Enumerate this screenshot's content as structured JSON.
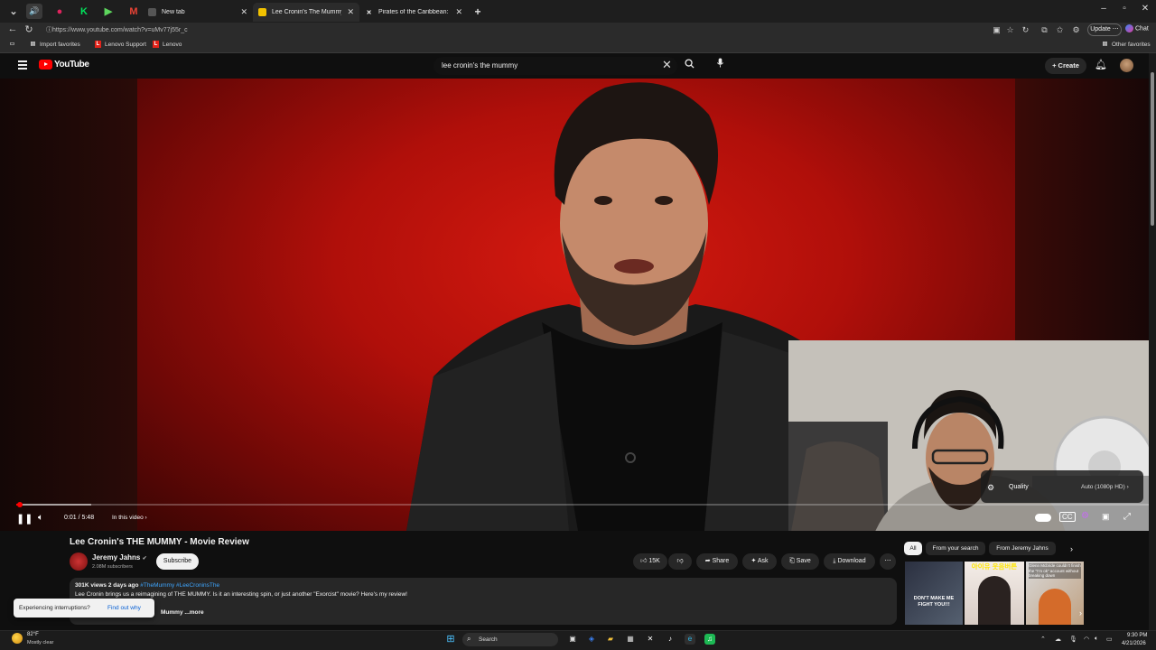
{
  "browser": {
    "tabs": [
      {
        "label": "New tab"
      },
      {
        "label": "Lee Cronin's The Mummy (2026) -"
      },
      {
        "label": "Pirates of the Caribbean: Dead M..."
      }
    ],
    "url": "https://www.youtube.com/watch?v=uMv77j55r_c",
    "update_label": "Update",
    "chat_label": "Chat",
    "favorites": [
      {
        "label": "Import favorites"
      },
      {
        "label": "Lenovo Support"
      },
      {
        "label": "Lenovo"
      }
    ],
    "other_favorites": "Other favorites"
  },
  "youtube": {
    "logo_text": "YouTube",
    "search_query": "lee cronin's the mummy",
    "create_label": "Create"
  },
  "player": {
    "time": "0:01 / 5:48",
    "in_this_video": "In this video",
    "progress_fraction": 0.003,
    "quality_label": "Quality",
    "quality_value": "Auto (1080p HD)"
  },
  "video": {
    "title": "Lee Cronin's THE MUMMY - Movie Review",
    "channel": "Jeremy Jahns",
    "subscribers": "2.08M subscribers",
    "subscribe_label": "Subscribe",
    "like_count": "15K",
    "share_label": "Share",
    "ask_label": "Ask",
    "save_label": "Save",
    "download_label": "Download",
    "views_date": "301K views  2 days ago",
    "tags": "#TheMummy #LeeCroninsThe",
    "description": "Lee Cronin brings us a reimagining of THE MUMMY. Is it an interesting spin, or just another \"Exorcist\" movie? Here's my review!",
    "more_text": "Mummy ...more"
  },
  "toast": {
    "text": "Experiencing interruptions?",
    "link": "Find out why"
  },
  "sidebar": {
    "chips": [
      "All",
      "From your search",
      "From Jeremy Jahns"
    ],
    "thumb_texts": [
      "DON'T MAKE ME FIGHT YOU!!!",
      "아이유 웃음버튼",
      "Glenn Mcbride couldn't finish the \"I'm ok\" account without breaking down"
    ]
  },
  "taskbar": {
    "temp": "82°F",
    "weather": "Mostly clear",
    "search_label": "Search",
    "time": "9:30 PM",
    "date": "4/21/2026"
  },
  "colors": {
    "yt_red": "#ff0000",
    "link_blue": "#3ea6ff"
  }
}
